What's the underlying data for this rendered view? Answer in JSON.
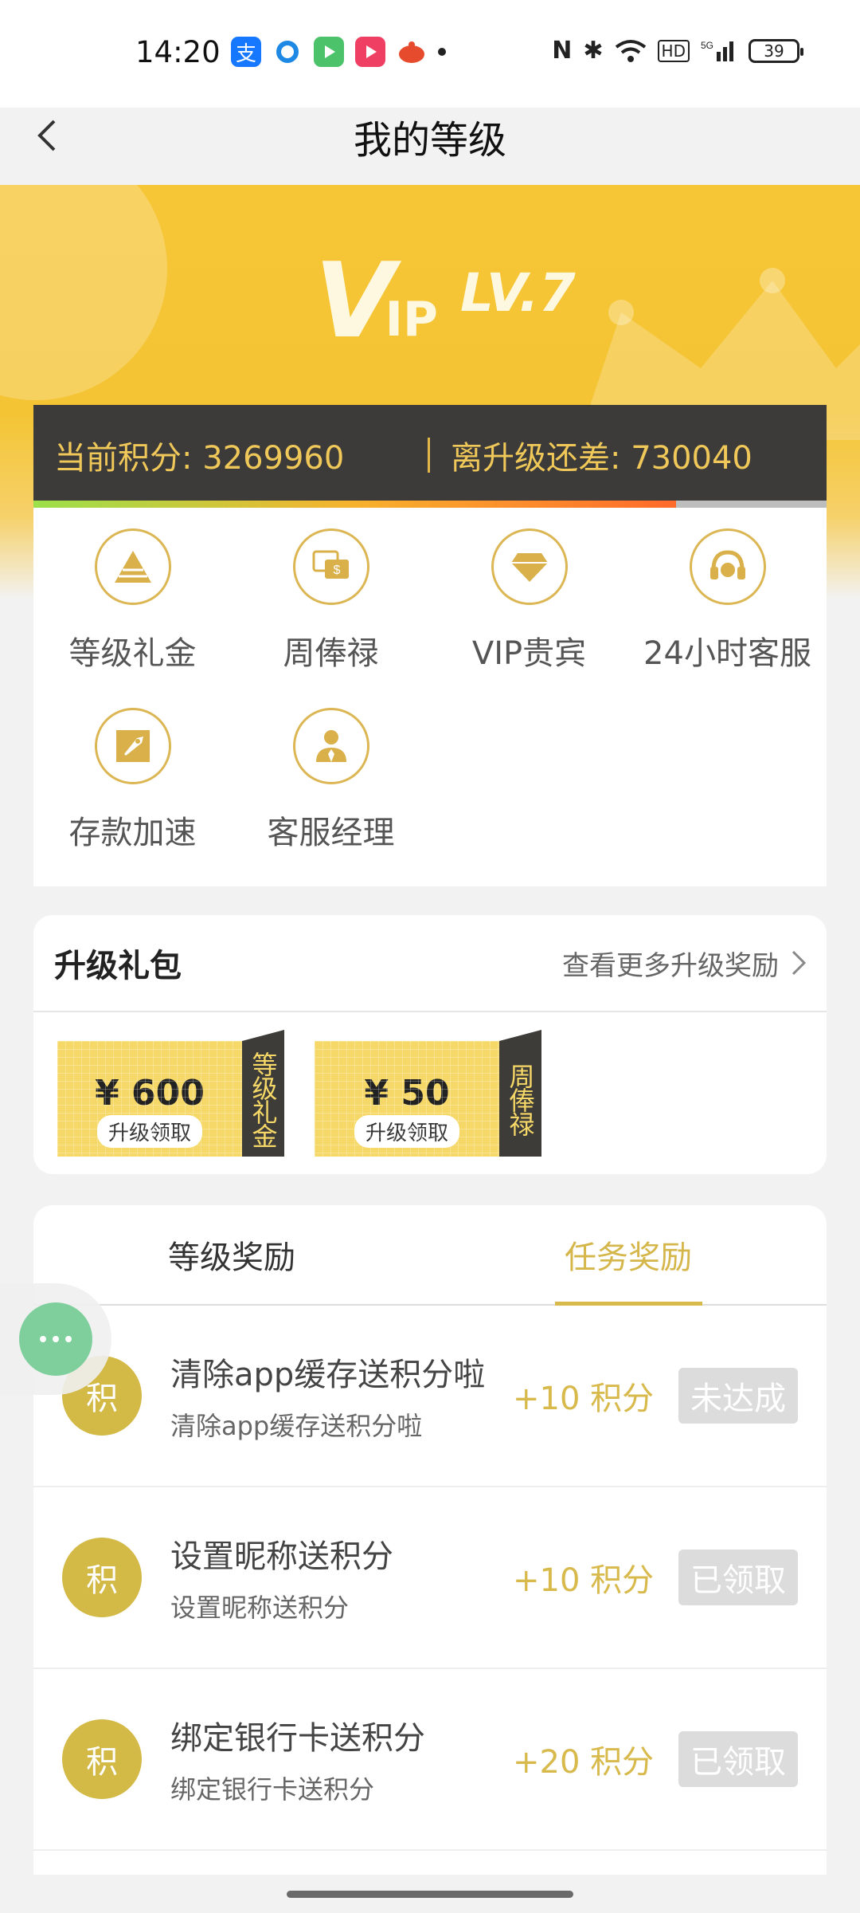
{
  "status_bar": {
    "time": "14:20",
    "app_icons": [
      {
        "name": "alipay-icon",
        "color": "#1677ff"
      },
      {
        "name": "circle-app-icon",
        "color": "#1e88e5"
      },
      {
        "name": "video-app-icon",
        "color": "#f7a13a"
      },
      {
        "name": "play-app-icon",
        "color": "#ef3f62"
      },
      {
        "name": "ladybug-app-icon",
        "color": "#e54b2c"
      }
    ],
    "battery": "39"
  },
  "header": {
    "title": "我的等级"
  },
  "vip": {
    "v": "V",
    "ip": "IP",
    "level": "LV.7"
  },
  "points": {
    "current_label": "当前积分: 3269960",
    "remaining_label": "离升级还差: 730040",
    "progress": 0.81
  },
  "privileges": [
    {
      "label": "等级礼金",
      "icon": "pyramid-icon"
    },
    {
      "label": "周俸禄",
      "icon": "salary-chat-icon"
    },
    {
      "label": "VIP贵宾",
      "icon": "diamond-icon"
    },
    {
      "label": "24小时客服",
      "icon": "headset-icon"
    },
    {
      "label": "存款加速",
      "icon": "rocket-icon"
    },
    {
      "label": "客服经理",
      "icon": "manager-icon"
    }
  ],
  "upgrade_gift": {
    "title": "升级礼包",
    "more": "查看更多升级奖励",
    "vouchers": [
      {
        "amount": "¥ 600",
        "button": "升级领取",
        "side": "等级礼金"
      },
      {
        "amount": "¥ 50",
        "button": "升级领取",
        "side": "周俸禄"
      }
    ]
  },
  "tabs": [
    {
      "label": "等级奖励",
      "active": false
    },
    {
      "label": "任务奖励",
      "active": true
    }
  ],
  "tasks": [
    {
      "badge": "积",
      "title": "清除app缓存送积分啦",
      "subtitle": "清除app缓存送积分啦",
      "reward": "+10 积分",
      "status": "未达成"
    },
    {
      "badge": "积",
      "title": "设置昵称送积分",
      "subtitle": "设置昵称送积分",
      "reward": "+10 积分",
      "status": "已领取"
    },
    {
      "badge": "积",
      "title": "绑定银行卡送积分",
      "subtitle": "绑定银行卡送积分",
      "reward": "+20 积分",
      "status": "已领取"
    }
  ],
  "colors": {
    "accent": "#d8b94b",
    "hero": "#f6c637",
    "dark_bar": "#3c3b39"
  }
}
